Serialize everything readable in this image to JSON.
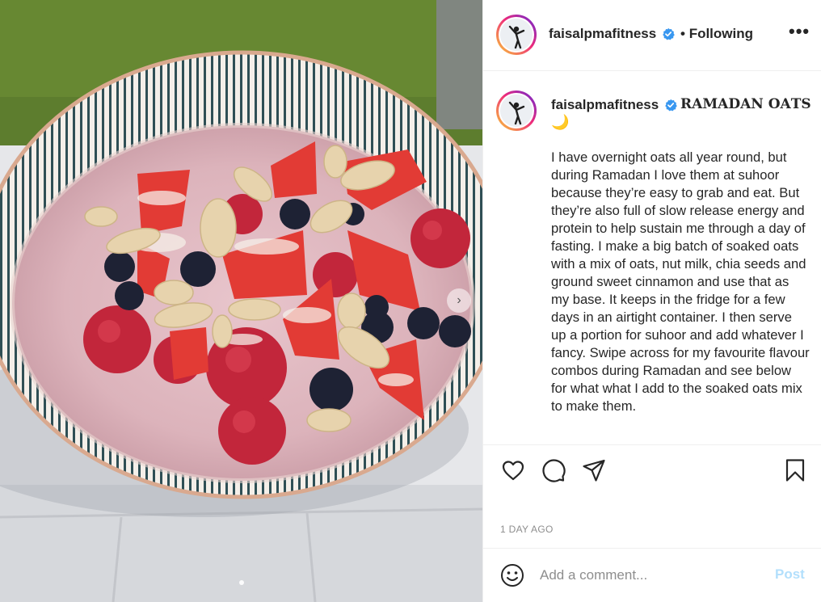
{
  "post": {
    "username": "faisalpmafitness",
    "follow_status": "Following",
    "more_label": "•••",
    "caption_title": "𝐑𝐀𝐌𝐀𝐃𝐀𝐍 𝐎𝐀𝐓𝐒",
    "caption_emoji": "🌙",
    "caption_body": "I have overnight oats all year round, but during Ramadan I love them at suhoor because they’re easy to grab and eat. But they’re also full of slow release energy and protein to help sustain me through a day of fasting. I make a big batch of soaked oats with a mix of oats, nut milk, chia seeds and ground sweet cinnamon and use that as my base. It keeps in the fridge for a few days in an airtight container. I then serve up a portion for suhoor and add whatever I fancy. Swipe across for my favourite flavour combos during Ramadan and see below for what what I add to the soaked oats mix to make them.",
    "timestamp": "1 DAY AGO"
  },
  "comment": {
    "placeholder": "Add a comment...",
    "post_label": "Post"
  },
  "carousel": {
    "next_glyph": "›",
    "current_index": 1,
    "total": 1
  },
  "icons": {
    "verified": "verified-badge-icon",
    "like": "heart-icon",
    "comment": "comment-bubble-icon",
    "share": "paper-plane-icon",
    "save": "bookmark-icon",
    "emoji": "smiley-icon"
  },
  "colors": {
    "verified_blue": "#3897f0",
    "text": "#262626",
    "muted": "#8e8e8e",
    "post_disabled": "#b2dffc",
    "divider": "#efefef"
  }
}
